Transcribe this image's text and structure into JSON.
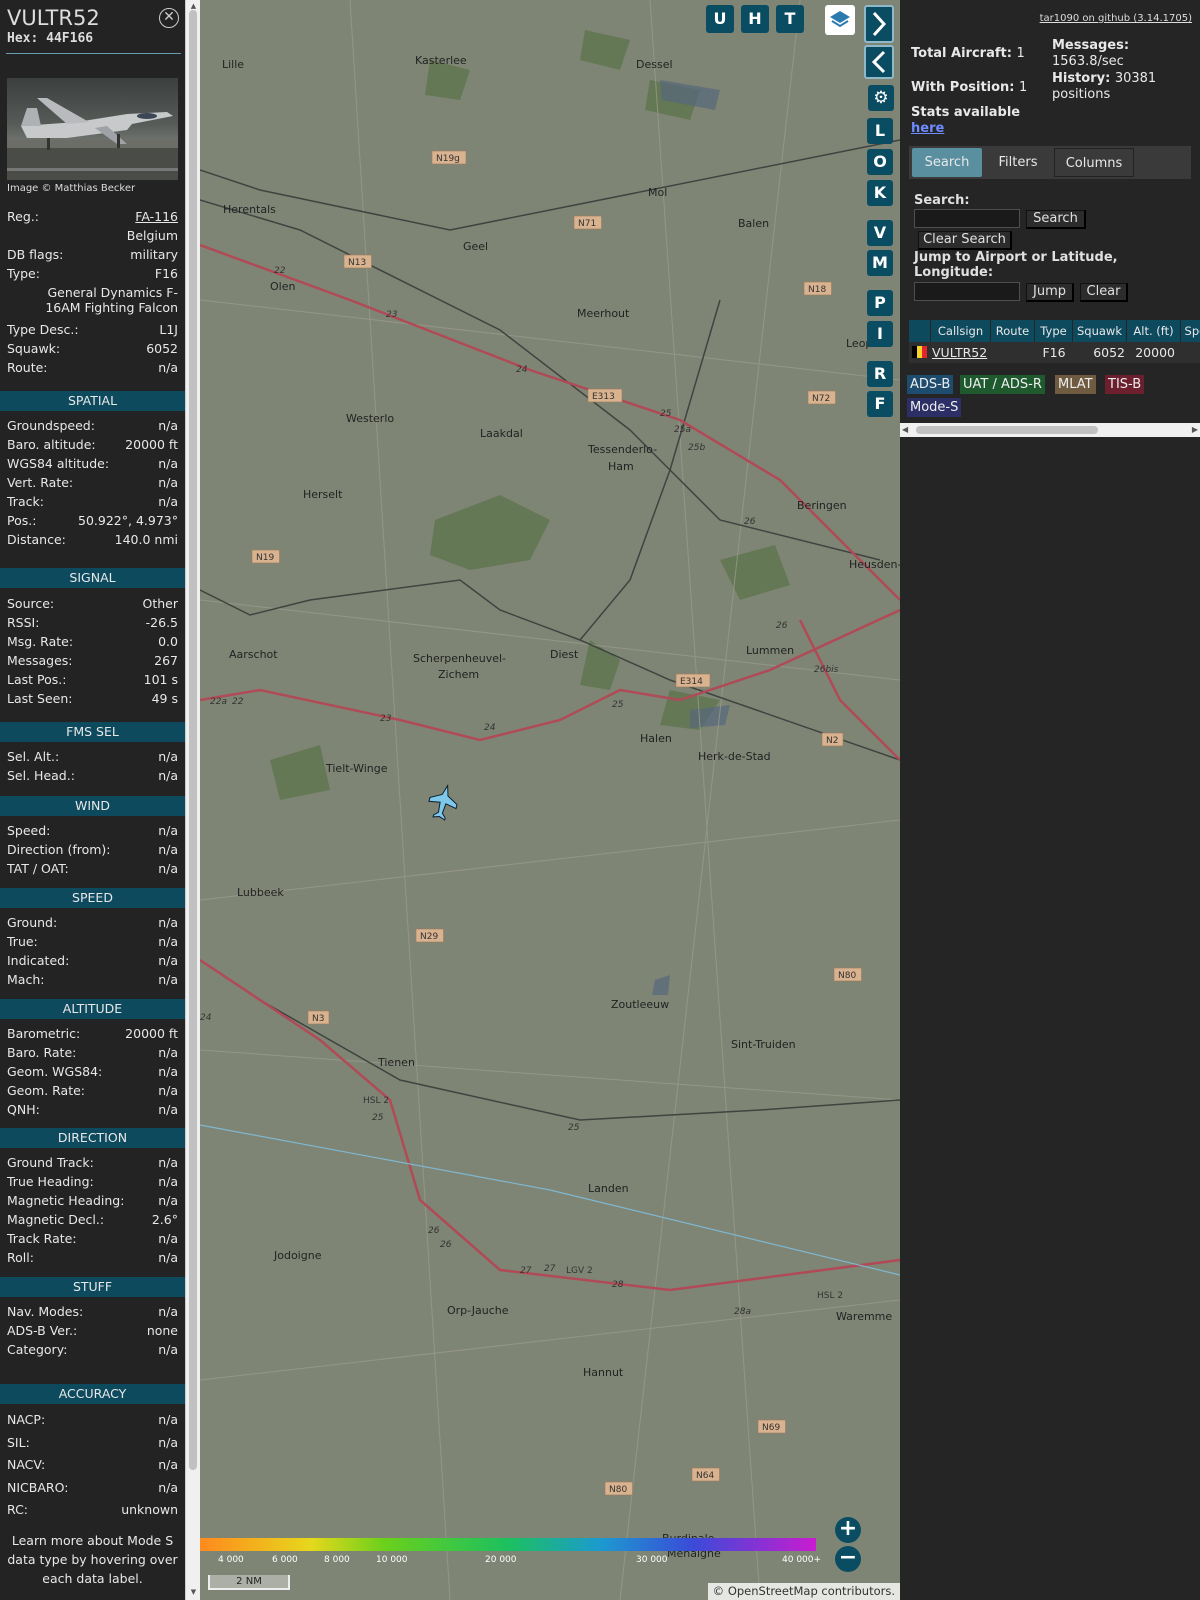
{
  "aircraft": {
    "callsign": "VULTR52",
    "hex_label": "Hex:",
    "hex": "44F166",
    "image_credit": "Image © Matthias Becker",
    "close_icon": "close-icon"
  },
  "details": [
    {
      "k": "Reg.:",
      "v": "FA-116",
      "link": true
    },
    {
      "k": "",
      "v": "Belgium"
    },
    {
      "k": "DB flags:",
      "v": "military"
    },
    {
      "k": "Type:",
      "v": "F16"
    },
    {
      "k": "",
      "v": "General Dynamics F-16AM Fighting Falcon"
    },
    {
      "k": "Type Desc.:",
      "v": "L1J"
    },
    {
      "k": "Squawk:",
      "v": "6052"
    },
    {
      "k": "Route:",
      "v": "n/a"
    }
  ],
  "sections": [
    {
      "title": "SPATIAL",
      "rows": [
        {
          "k": "Groundspeed:",
          "v": "n/a"
        },
        {
          "k": "Baro. altitude:",
          "v": "20000 ft"
        },
        {
          "k": "WGS84 altitude:",
          "v": "n/a"
        },
        {
          "k": "Vert. Rate:",
          "v": "n/a"
        },
        {
          "k": "Track:",
          "v": "n/a"
        },
        {
          "k": "Pos.:",
          "v": "50.922°, 4.973°"
        },
        {
          "k": "Distance:",
          "v": "140.0 nmi"
        }
      ]
    },
    {
      "title": "SIGNAL",
      "rows": [
        {
          "k": "Source:",
          "v": "Other"
        },
        {
          "k": "RSSI:",
          "v": "-26.5"
        },
        {
          "k": "Msg. Rate:",
          "v": "0.0"
        },
        {
          "k": "Messages:",
          "v": "267"
        },
        {
          "k": "Last Pos.:",
          "v": "101 s"
        },
        {
          "k": "Last Seen:",
          "v": "49 s"
        }
      ]
    },
    {
      "title": "FMS SEL",
      "rows": [
        {
          "k": "Sel. Alt.:",
          "v": "n/a"
        },
        {
          "k": "Sel. Head.:",
          "v": "n/a"
        }
      ]
    },
    {
      "title": "WIND",
      "rows": [
        {
          "k": "Speed:",
          "v": "n/a"
        },
        {
          "k": "Direction (from):",
          "v": "n/a"
        },
        {
          "k": "TAT / OAT:",
          "v": "n/a"
        }
      ]
    },
    {
      "title": "SPEED",
      "rows": [
        {
          "k": "Ground:",
          "v": "n/a"
        },
        {
          "k": "True:",
          "v": "n/a"
        },
        {
          "k": "Indicated:",
          "v": "n/a"
        },
        {
          "k": "Mach:",
          "v": "n/a"
        }
      ]
    },
    {
      "title": "ALTITUDE",
      "rows": [
        {
          "k": "Barometric:",
          "v": "20000 ft"
        },
        {
          "k": "Baro. Rate:",
          "v": "n/a"
        },
        {
          "k": "Geom. WGS84:",
          "v": "n/a"
        },
        {
          "k": "Geom. Rate:",
          "v": "n/a"
        },
        {
          "k": "QNH:",
          "v": "n/a"
        }
      ]
    },
    {
      "title": "DIRECTION",
      "rows": [
        {
          "k": "Ground Track:",
          "v": "n/a"
        },
        {
          "k": "True Heading:",
          "v": "n/a"
        },
        {
          "k": "Magnetic Heading:",
          "v": "n/a"
        },
        {
          "k": "Magnetic Decl.:",
          "v": "2.6°"
        },
        {
          "k": "Track Rate:",
          "v": "n/a"
        },
        {
          "k": "Roll:",
          "v": "n/a"
        }
      ]
    },
    {
      "title": "STUFF",
      "rows": [
        {
          "k": "Nav. Modes:",
          "v": "n/a"
        },
        {
          "k": "ADS-B Ver.:",
          "v": "none"
        },
        {
          "k": "Category:",
          "v": "n/a"
        }
      ]
    },
    {
      "title": "ACCURACY",
      "rows": [
        {
          "k": "NACP:",
          "v": "n/a"
        },
        {
          "k": "SIL:",
          "v": "n/a"
        },
        {
          "k": "NACV:",
          "v": "n/a"
        },
        {
          "k": "NICBARO:",
          "v": "n/a"
        },
        {
          "k": "RC:",
          "v": "unknown"
        }
      ]
    }
  ],
  "learn_more": "Learn more about Mode S data type by hovering over each data label.",
  "map": {
    "towns": [
      {
        "name": "Lille"
      },
      {
        "name": "Kasterlee"
      },
      {
        "name": "Dessel"
      },
      {
        "name": "Herentals"
      },
      {
        "name": "Geel"
      },
      {
        "name": "Mol"
      },
      {
        "name": "Balen"
      },
      {
        "name": "Olen"
      },
      {
        "name": "Meerhout"
      },
      {
        "name": "Leopo"
      },
      {
        "name": "Westerlo"
      },
      {
        "name": "Laakdal"
      },
      {
        "name": "Tessenderlo-"
      },
      {
        "name": "Ham"
      },
      {
        "name": "Herselt"
      },
      {
        "name": "Beringen"
      },
      {
        "name": "Heusden-Z"
      },
      {
        "name": "Aarschot"
      },
      {
        "name": "Scherpenheuvel-"
      },
      {
        "name": "Zichem"
      },
      {
        "name": "Diest"
      },
      {
        "name": "Lummen"
      },
      {
        "name": "Halen"
      },
      {
        "name": "Herk-de-Stad"
      },
      {
        "name": "Tielt-Winge"
      },
      {
        "name": "Lubbeek"
      },
      {
        "name": "Zoutleeuw"
      },
      {
        "name": "Tienen"
      },
      {
        "name": "Sint-Truiden"
      },
      {
        "name": "Landen"
      },
      {
        "name": "Jodoigne"
      },
      {
        "name": "Orp-Jauche"
      },
      {
        "name": "Waremme"
      },
      {
        "name": "Hannut"
      },
      {
        "name": "Burdinale-"
      },
      {
        "name": "Mehaigne"
      }
    ],
    "roads": [
      "N19g",
      "N71",
      "N13",
      "N18",
      "E313",
      "N72",
      "N19",
      "E314",
      "N2",
      "N29",
      "N80",
      "N3",
      "N69",
      "N64",
      "N80",
      "LGV 2",
      "HSL 2",
      "HSL 2"
    ],
    "road_numbers": [
      "22",
      "23",
      "24",
      "25",
      "25a",
      "25b",
      "26",
      "26",
      "26bis",
      "22a",
      "22",
      "23",
      "24",
      "25",
      "24",
      "25",
      "25",
      "26",
      "26",
      "27",
      "27",
      "28",
      "28a",
      "27"
    ],
    "buttons": [
      "U",
      "H",
      "T",
      "L",
      "O",
      "K",
      "V",
      "M",
      "P",
      "I",
      "R",
      "F"
    ],
    "layers_icon": "layers-icon",
    "settings_icon": "gear-icon",
    "expand_icon": "chevron-right-icon",
    "collapse_icon": "chevron-left-icon",
    "toggle_icon": "arrows-horizontal-icon",
    "aircraft_icon": "airplane-icon",
    "altitude_scale": [
      "4 000",
      "6 000",
      "8 000",
      "10 000",
      "20 000",
      "30 000",
      "40 000+"
    ],
    "scale_label": "2 NM",
    "attribution_prefix": "©",
    "attribution_link": "OpenStreetMap",
    "attribution_suffix": "contributors.",
    "zoom_in": "+",
    "zoom_out": "−"
  },
  "right": {
    "github": "tar1090 on github (3.14.1705)",
    "total_aircraft_label": "Total Aircraft:",
    "total_aircraft": "1",
    "with_position_label": "With Position:",
    "with_position": "1",
    "messages_label": "Messages:",
    "messages_rate": "1563.8/sec",
    "history_label": "History:",
    "history_value": "30381",
    "history_unit": "positions",
    "stats_label": "Stats available",
    "stats_link": "here",
    "tabs": [
      "Search",
      "Filters",
      "Columns"
    ],
    "search_label": "Search:",
    "search_button": "Search",
    "clear_search_button": "Clear Search",
    "jump_label": "Jump to Airport or Latitude, Longitude:",
    "jump_button": "Jump",
    "clear_button": "Clear",
    "table_headers": [
      "Callsign",
      "Route",
      "Type",
      "Squawk",
      "Alt. (ft)",
      "Spd"
    ],
    "table_row": {
      "callsign": "VULTR52",
      "route": "",
      "type": "F16",
      "squawk": "6052",
      "alt": "20000",
      "spd": ""
    },
    "source_badges": [
      {
        "label": "ADS-B",
        "color": "#1e4c6e"
      },
      {
        "label": "UAT / ADS-R",
        "color": "#1f5a2e"
      },
      {
        "label": "MLAT",
        "color": "#6e5b40"
      },
      {
        "label": "TIS-B",
        "color": "#6c1f2c"
      },
      {
        "label": "Mode-S",
        "color": "#2b2f66"
      }
    ],
    "belgium_flag": [
      "#000000",
      "#f6d42c",
      "#e3262c"
    ]
  }
}
